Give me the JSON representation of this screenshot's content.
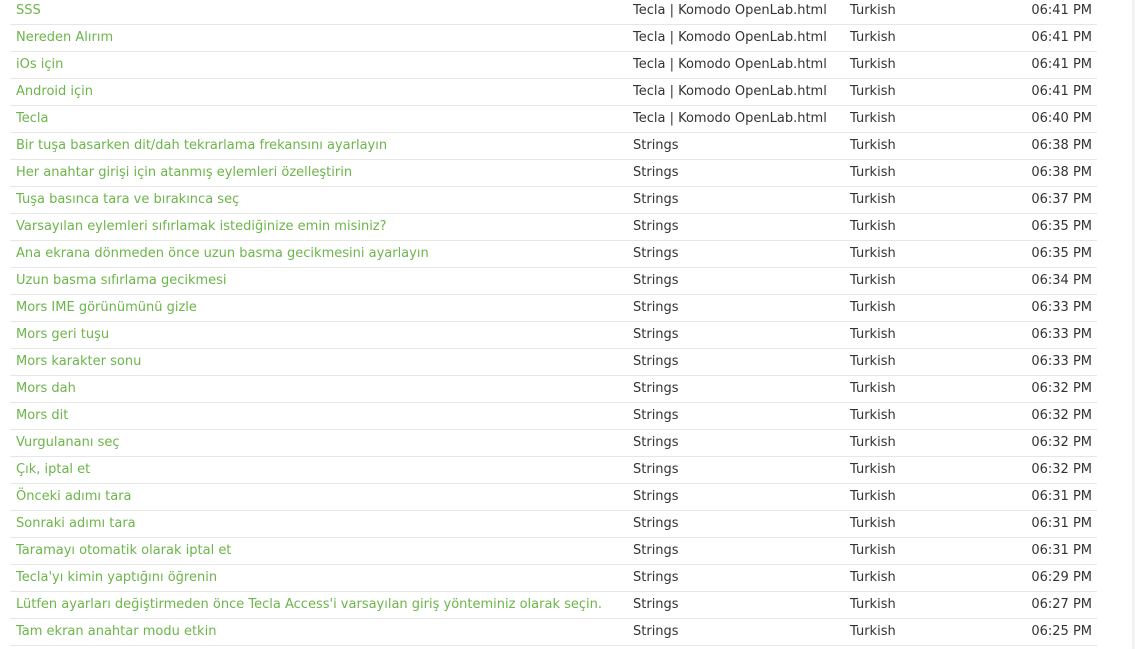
{
  "rows": [
    {
      "title": "SSS",
      "source": "Tecla | Komodo OpenLab.html",
      "language": "Turkish",
      "time": "06:41 PM"
    },
    {
      "title": "Nereden Alırım",
      "source": "Tecla | Komodo OpenLab.html",
      "language": "Turkish",
      "time": "06:41 PM"
    },
    {
      "title": "iOs için",
      "source": "Tecla | Komodo OpenLab.html",
      "language": "Turkish",
      "time": "06:41 PM"
    },
    {
      "title": "Android için",
      "source": "Tecla | Komodo OpenLab.html",
      "language": "Turkish",
      "time": "06:41 PM"
    },
    {
      "title": "Tecla",
      "source": "Tecla | Komodo OpenLab.html",
      "language": "Turkish",
      "time": "06:40 PM"
    },
    {
      "title": "Bir tuşa basarken dit/dah tekrarlama frekansını ayarlayın",
      "source": "Strings",
      "language": "Turkish",
      "time": "06:38 PM"
    },
    {
      "title": "Her anahtar girişi için atanmış eylemleri özelleştirin",
      "source": "Strings",
      "language": "Turkish",
      "time": "06:38 PM"
    },
    {
      "title": "Tuşa basınca tara ve bırakınca seç",
      "source": "Strings",
      "language": "Turkish",
      "time": "06:37 PM"
    },
    {
      "title": "Varsayılan eylemleri sıfırlamak istediğinize emin misiniz?",
      "source": "Strings",
      "language": "Turkish",
      "time": "06:35 PM"
    },
    {
      "title": "Ana ekrana dönmeden önce uzun basma gecikmesini ayarlayın",
      "source": "Strings",
      "language": "Turkish",
      "time": "06:35 PM"
    },
    {
      "title": "Uzun basma sıfırlama gecikmesi",
      "source": "Strings",
      "language": "Turkish",
      "time": "06:34 PM"
    },
    {
      "title": "Mors IME görünümünü gizle",
      "source": "Strings",
      "language": "Turkish",
      "time": "06:33 PM"
    },
    {
      "title": "Mors geri tuşu",
      "source": "Strings",
      "language": "Turkish",
      "time": "06:33 PM"
    },
    {
      "title": "Mors karakter sonu",
      "source": "Strings",
      "language": "Turkish",
      "time": "06:33 PM"
    },
    {
      "title": "Mors dah",
      "source": "Strings",
      "language": "Turkish",
      "time": "06:32 PM"
    },
    {
      "title": "Mors dit",
      "source": "Strings",
      "language": "Turkish",
      "time": "06:32 PM"
    },
    {
      "title": "Vurgulananı seç",
      "source": "Strings",
      "language": "Turkish",
      "time": "06:32 PM"
    },
    {
      "title": "Çık, iptal et",
      "source": "Strings",
      "language": "Turkish",
      "time": "06:32 PM"
    },
    {
      "title": "Önceki adımı tara",
      "source": "Strings",
      "language": "Turkish",
      "time": "06:31 PM"
    },
    {
      "title": "Sonraki adımı tara",
      "source": "Strings",
      "language": "Turkish",
      "time": "06:31 PM"
    },
    {
      "title": "Taramayı otomatik olarak iptal et",
      "source": "Strings",
      "language": "Turkish",
      "time": "06:31 PM"
    },
    {
      "title": "Tecla'yı kimin yaptığını öğrenin",
      "source": "Strings",
      "language": "Turkish",
      "time": "06:29 PM"
    },
    {
      "title": "Lütfen ayarları değiştirmeden önce Tecla Access'i varsayılan giriş yönteminiz olarak seçin.",
      "source": "Strings",
      "language": "Turkish",
      "time": "06:27 PM"
    },
    {
      "title": "Tam ekran anahtar modu etkin",
      "source": "Strings",
      "language": "Turkish",
      "time": "06:25 PM"
    }
  ],
  "colors": {
    "link": "#6cb54a",
    "text": "#333333",
    "divider": "#e6e6e6"
  }
}
